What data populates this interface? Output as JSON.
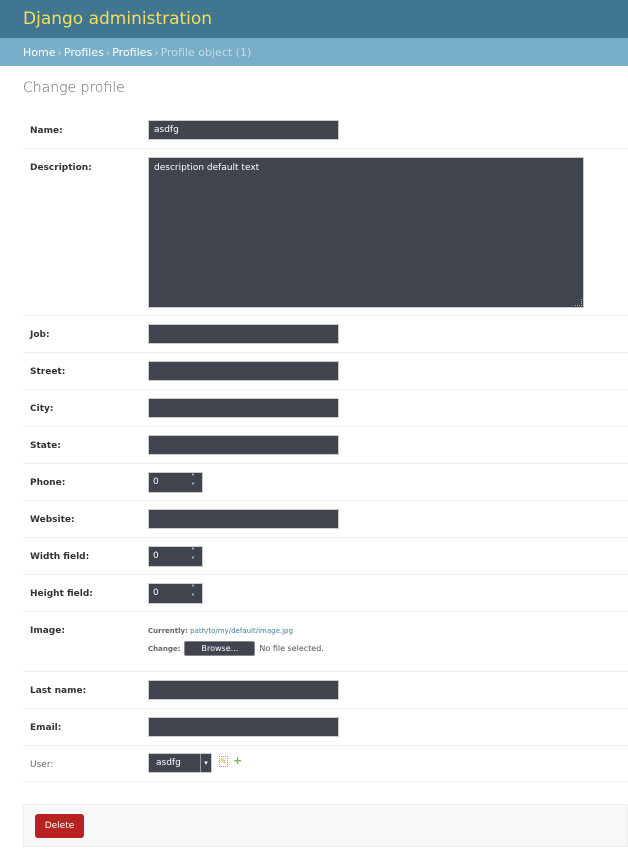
{
  "header": {
    "brand": "Django administration"
  },
  "breadcrumbs": {
    "home": "Home",
    "app": "Profiles",
    "model": "Profiles",
    "current": "Profile object (1)",
    "separator": "›"
  },
  "page_title": "Change profile",
  "fields": {
    "name": {
      "label": "Name:",
      "value": "asdfg"
    },
    "description": {
      "label": "Description:",
      "value": "description default text"
    },
    "job": {
      "label": "Job:",
      "value": ""
    },
    "street": {
      "label": "Street:",
      "value": ""
    },
    "city": {
      "label": "City:",
      "value": ""
    },
    "state": {
      "label": "State:",
      "value": ""
    },
    "phone": {
      "label": "Phone:",
      "value": "0"
    },
    "website": {
      "label": "Website:",
      "value": ""
    },
    "width_field": {
      "label": "Width field:",
      "value": "0"
    },
    "height_field": {
      "label": "Height field:",
      "value": "0"
    },
    "image": {
      "label": "Image:",
      "currently_label": "Currently:",
      "current_path": "path/to/my/default/image.jpg",
      "change_label": "Change:",
      "browse_label": "Browse...",
      "no_file_text": "No file selected."
    },
    "last_name": {
      "label": "Last name:",
      "value": ""
    },
    "email": {
      "label": "Email:",
      "value": ""
    },
    "user": {
      "label": "User:",
      "value": "asdfg"
    }
  },
  "actions": {
    "delete_label": "Delete"
  },
  "colors": {
    "header_bg": "#417690",
    "brand": "#f5dd5d",
    "breadcrumbs_bg": "#79aec8",
    "input_bg": "#3f444f",
    "delete_bg": "#ba2121",
    "add_icon": "#70bf2b"
  },
  "icons": {
    "spin_up": "˄",
    "spin_down": "˅",
    "select_arrow": "▾",
    "pencil": "✎",
    "plus": "+"
  }
}
